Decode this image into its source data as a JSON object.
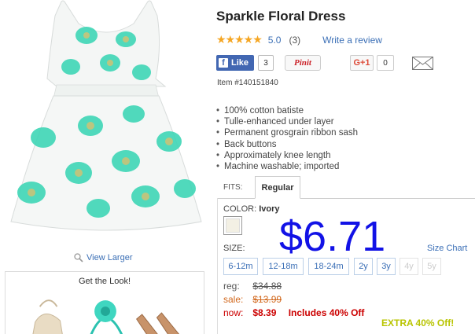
{
  "product": {
    "title": "Sparkle Floral Dress",
    "stars": "★★★★★",
    "rating": "5.0",
    "review_count": "(3)",
    "write_review": "Write a review",
    "item_number": "Item #140151840",
    "features": [
      "100% cotton batiste",
      "Tulle-enhanced under layer",
      "Permanent grosgrain ribbon sash",
      "Back buttons",
      "Approximately knee length",
      "Machine washable; imported"
    ]
  },
  "social": {
    "fb_icon": "f",
    "fb_like": "Like",
    "fb_count": "3",
    "pinit": "Pinit",
    "gplus": "G+1",
    "gplus_count": "0"
  },
  "left": {
    "view_larger": "View Larger",
    "get_look": "Get the Look!"
  },
  "fits": {
    "label": "FITS:",
    "tab": "Regular"
  },
  "color": {
    "label": "COLOR:",
    "value": "Ivory",
    "swatch_hex": "#f3f0e4"
  },
  "overlay_price": "$6.71",
  "size": {
    "label": "SIZE:",
    "chart_link": "Size Chart",
    "options": [
      "6-12m",
      "12-18m",
      "18-24m",
      "2y",
      "3y",
      "4y",
      "5y"
    ]
  },
  "prices": {
    "reg_label": "reg:",
    "reg_value": "$34.88",
    "sale_label": "sale:",
    "sale_value": "$13.99",
    "now_label": "now:",
    "now_value": "$8.39",
    "promo": "Includes 40% Off",
    "extra": "EXTRA 40% Off!"
  },
  "colors": {
    "link": "#3b6fb6",
    "star": "#f5a623",
    "facebook": "#4267b2",
    "price_overlay": "#1212e6",
    "now": "#cc0000",
    "sale": "#d2691e",
    "extra": "#b8c400",
    "dress_print": "#3fd6b6"
  }
}
